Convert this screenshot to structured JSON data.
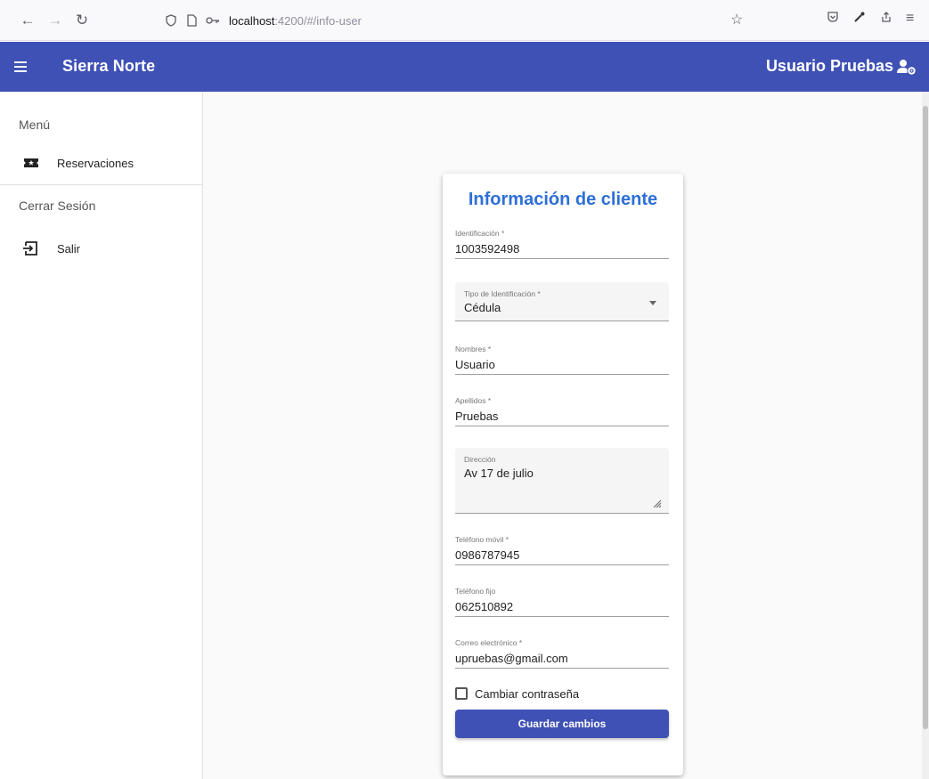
{
  "browser": {
    "url_host": "localhost",
    "url_path": ":4200/#/info-user"
  },
  "toolbar": {
    "app_title": "Sierra Norte",
    "user_name": "Usuario Pruebas"
  },
  "sidenav": {
    "menu_title": "Menú",
    "reservations_label": "Reservaciones",
    "logout_title": "Cerrar Sesión",
    "exit_label": "Salir"
  },
  "form": {
    "title": "Información de cliente",
    "identificacion": {
      "label": "Identificación *",
      "value": "1003592498"
    },
    "tipo": {
      "label": "Tipo de Identificación *",
      "value": "Cédula"
    },
    "nombres": {
      "label": "Nombres *",
      "value": "Usuario"
    },
    "apellidos": {
      "label": "Apellidos *",
      "value": "Pruebas"
    },
    "direccion": {
      "label": "Dirección",
      "value": "Av 17 de julio"
    },
    "movil": {
      "label": "Teléfono móvil *",
      "value": "0986787945"
    },
    "fijo": {
      "label": "Teléfono fijo",
      "value": "062510892"
    },
    "correo": {
      "label": "Correo electrónico *",
      "value": "upruebas@gmail.com"
    },
    "change_password_label": "Cambiar contraseña",
    "save_label": "Guardar cambios"
  },
  "colors": {
    "primary": "#3f51b5",
    "title_blue": "#2e6fd8"
  }
}
